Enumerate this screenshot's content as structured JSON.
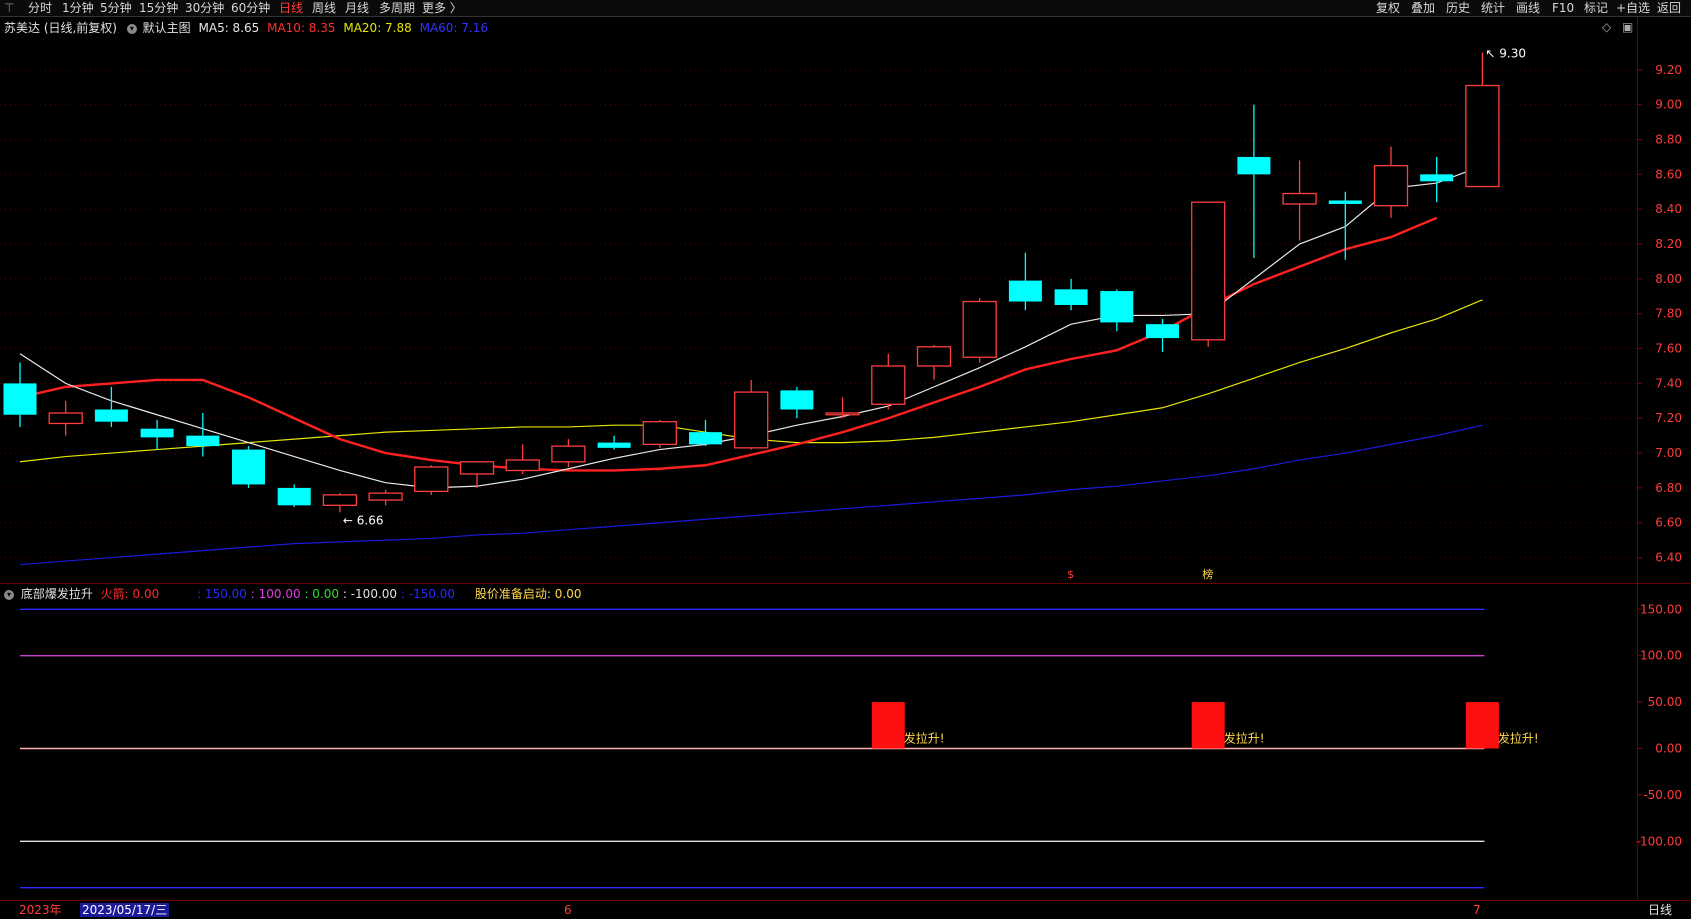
{
  "toolbar": {
    "periods": [
      "分时",
      "1分钟",
      "5分钟",
      "15分钟",
      "30分钟",
      "60分钟",
      "日线",
      "周线",
      "月线",
      "多周期",
      "更多 〉"
    ],
    "active_period": "日线",
    "actions": [
      "复权",
      "叠加",
      "历史",
      "统计",
      "画线",
      "F10",
      "标记",
      "+自选",
      "返回"
    ]
  },
  "main_legend": {
    "title": "苏美达 (日线,前复权)",
    "template": "默认主图",
    "ma5": "MA5: 8.65",
    "ma10": "MA10: 8.35",
    "ma20": "MA20: 7.88",
    "ma60": "MA60: 7.16"
  },
  "sub_legend": {
    "title": "底部爆发拉升",
    "items": [
      {
        "text": "火箭: 0.00",
        "color": "#ff2a2a"
      },
      {
        "text": ": 150.00",
        "color": "#2a2aff"
      },
      {
        "text": ": 100.00",
        "color": "#e040e0"
      },
      {
        "text": ": 0.00",
        "color": "#33dd33"
      },
      {
        "text": ": -100.00",
        "color": "#e0e0e0"
      },
      {
        "text": ": -150.00",
        "color": "#2a2aff"
      },
      {
        "text": "股价准备启动: 0.00",
        "color": "#ffd84a"
      }
    ]
  },
  "bottom": {
    "year": "2023年",
    "cursor_date": "2023/05/17/三",
    "month_labels": [
      "6",
      "7"
    ],
    "period_label": "日线"
  },
  "colors": {
    "up": "#ff3d3d",
    "down": "#00ffff",
    "ma5": "#e8e8e8",
    "ma10": "#ff2020",
    "ma20": "#e6e600",
    "ma60": "#1a1adc"
  },
  "chart_data": [
    {
      "type": "candlestick",
      "ylim": [
        6.3,
        9.4
      ],
      "yticks": [
        "9.20",
        "9.00",
        "8.80",
        "8.60",
        "8.40",
        "8.20",
        "8.00",
        "7.80",
        "7.60",
        "7.40",
        "7.20",
        "7.00",
        "6.80",
        "6.60",
        "6.40"
      ],
      "high_label": "9.30",
      "low_label": "6.66",
      "markers": [
        "$",
        "榜"
      ],
      "candles": [
        {
          "o": 7.4,
          "h": 7.52,
          "l": 7.15,
          "c": 7.22
        },
        {
          "o": 7.17,
          "h": 7.3,
          "l": 7.1,
          "c": 7.23
        },
        {
          "o": 7.25,
          "h": 7.38,
          "l": 7.15,
          "c": 7.18
        },
        {
          "o": 7.14,
          "h": 7.19,
          "l": 7.02,
          "c": 7.09
        },
        {
          "o": 7.1,
          "h": 7.23,
          "l": 6.98,
          "c": 7.04
        },
        {
          "o": 7.02,
          "h": 7.04,
          "l": 6.8,
          "c": 6.82
        },
        {
          "o": 6.8,
          "h": 6.82,
          "l": 6.69,
          "c": 6.7
        },
        {
          "o": 6.7,
          "h": 6.77,
          "l": 6.66,
          "c": 6.76
        },
        {
          "o": 6.73,
          "h": 6.79,
          "l": 6.7,
          "c": 6.77
        },
        {
          "o": 6.78,
          "h": 6.93,
          "l": 6.76,
          "c": 6.92
        },
        {
          "o": 6.88,
          "h": 6.95,
          "l": 6.8,
          "c": 6.95
        },
        {
          "o": 6.9,
          "h": 7.05,
          "l": 6.88,
          "c": 6.96
        },
        {
          "o": 6.95,
          "h": 7.08,
          "l": 6.92,
          "c": 7.04
        },
        {
          "o": 7.06,
          "h": 7.1,
          "l": 7.02,
          "c": 7.03
        },
        {
          "o": 7.05,
          "h": 7.19,
          "l": 7.03,
          "c": 7.18
        },
        {
          "o": 7.12,
          "h": 7.19,
          "l": 7.04,
          "c": 7.05
        },
        {
          "o": 7.03,
          "h": 7.42,
          "l": 7.02,
          "c": 7.35
        },
        {
          "o": 7.36,
          "h": 7.38,
          "l": 7.2,
          "c": 7.25
        },
        {
          "o": 7.22,
          "h": 7.32,
          "l": 7.2,
          "c": 7.23
        },
        {
          "o": 7.28,
          "h": 7.57,
          "l": 7.25,
          "c": 7.5
        },
        {
          "o": 7.5,
          "h": 7.62,
          "l": 7.42,
          "c": 7.61
        },
        {
          "o": 7.55,
          "h": 7.89,
          "l": 7.52,
          "c": 7.87
        },
        {
          "o": 7.99,
          "h": 8.15,
          "l": 7.82,
          "c": 7.87
        },
        {
          "o": 7.94,
          "h": 8.0,
          "l": 7.82,
          "c": 7.85
        },
        {
          "o": 7.93,
          "h": 7.94,
          "l": 7.7,
          "c": 7.75
        },
        {
          "o": 7.74,
          "h": 7.77,
          "l": 7.58,
          "c": 7.66
        },
        {
          "o": 7.65,
          "h": 8.44,
          "l": 7.61,
          "c": 8.44
        },
        {
          "o": 8.7,
          "h": 9.0,
          "l": 8.12,
          "c": 8.6
        },
        {
          "o": 8.43,
          "h": 8.68,
          "l": 8.22,
          "c": 8.49
        },
        {
          "o": 8.45,
          "h": 8.5,
          "l": 8.11,
          "c": 8.43
        },
        {
          "o": 8.42,
          "h": 8.76,
          "l": 8.35,
          "c": 8.65
        },
        {
          "o": 8.6,
          "h": 8.7,
          "l": 8.44,
          "c": 8.56
        },
        {
          "o": 8.53,
          "h": 9.3,
          "l": 8.53,
          "c": 9.11
        }
      ],
      "ma5": [
        7.57,
        7.4,
        7.3,
        7.22,
        7.14,
        7.06,
        6.98,
        6.9,
        6.83,
        6.8,
        6.81,
        6.85,
        6.91,
        6.97,
        7.02,
        7.05,
        7.1,
        7.16,
        7.21,
        7.27,
        7.38,
        7.49,
        7.61,
        7.74,
        7.79,
        7.79,
        7.8,
        8.0,
        8.2,
        8.3,
        8.52,
        8.55,
        8.65
      ],
      "ma10": [
        7.32,
        7.38,
        7.4,
        7.42,
        7.42,
        7.32,
        7.2,
        7.08,
        7.0,
        6.96,
        6.93,
        6.91,
        6.9,
        6.9,
        6.91,
        6.93,
        6.99,
        7.05,
        7.12,
        7.2,
        7.29,
        7.38,
        7.48,
        7.54,
        7.59,
        7.7,
        7.84,
        7.97,
        8.07,
        8.17,
        8.24,
        8.35
      ],
      "ma20": [
        6.95,
        6.98,
        7.0,
        7.02,
        7.04,
        7.06,
        7.08,
        7.1,
        7.12,
        7.13,
        7.14,
        7.15,
        7.15,
        7.16,
        7.16,
        7.12,
        7.08,
        7.06,
        7.06,
        7.07,
        7.09,
        7.12,
        7.15,
        7.18,
        7.22,
        7.26,
        7.34,
        7.43,
        7.52,
        7.6,
        7.69,
        7.77,
        7.88
      ],
      "ma60": [
        6.36,
        6.38,
        6.4,
        6.42,
        6.44,
        6.46,
        6.48,
        6.49,
        6.5,
        6.51,
        6.53,
        6.54,
        6.56,
        6.58,
        6.6,
        6.62,
        6.64,
        6.66,
        6.68,
        6.7,
        6.72,
        6.74,
        6.76,
        6.79,
        6.81,
        6.84,
        6.87,
        6.91,
        6.96,
        7.0,
        7.05,
        7.1,
        7.16
      ]
    },
    {
      "type": "bar",
      "ylim": [
        -160,
        160
      ],
      "yticks": [
        "150.00",
        "100.00",
        "50.00",
        "0.00",
        "-50.00",
        "-100.00"
      ],
      "reference_lines": [
        150,
        100,
        0,
        -100,
        -150
      ],
      "signal_bars": [
        {
          "index": 19,
          "value": 50
        },
        {
          "index": 26,
          "value": 50
        },
        {
          "index": 32,
          "value": 50
        }
      ],
      "signal_text": "发拉升!"
    }
  ]
}
